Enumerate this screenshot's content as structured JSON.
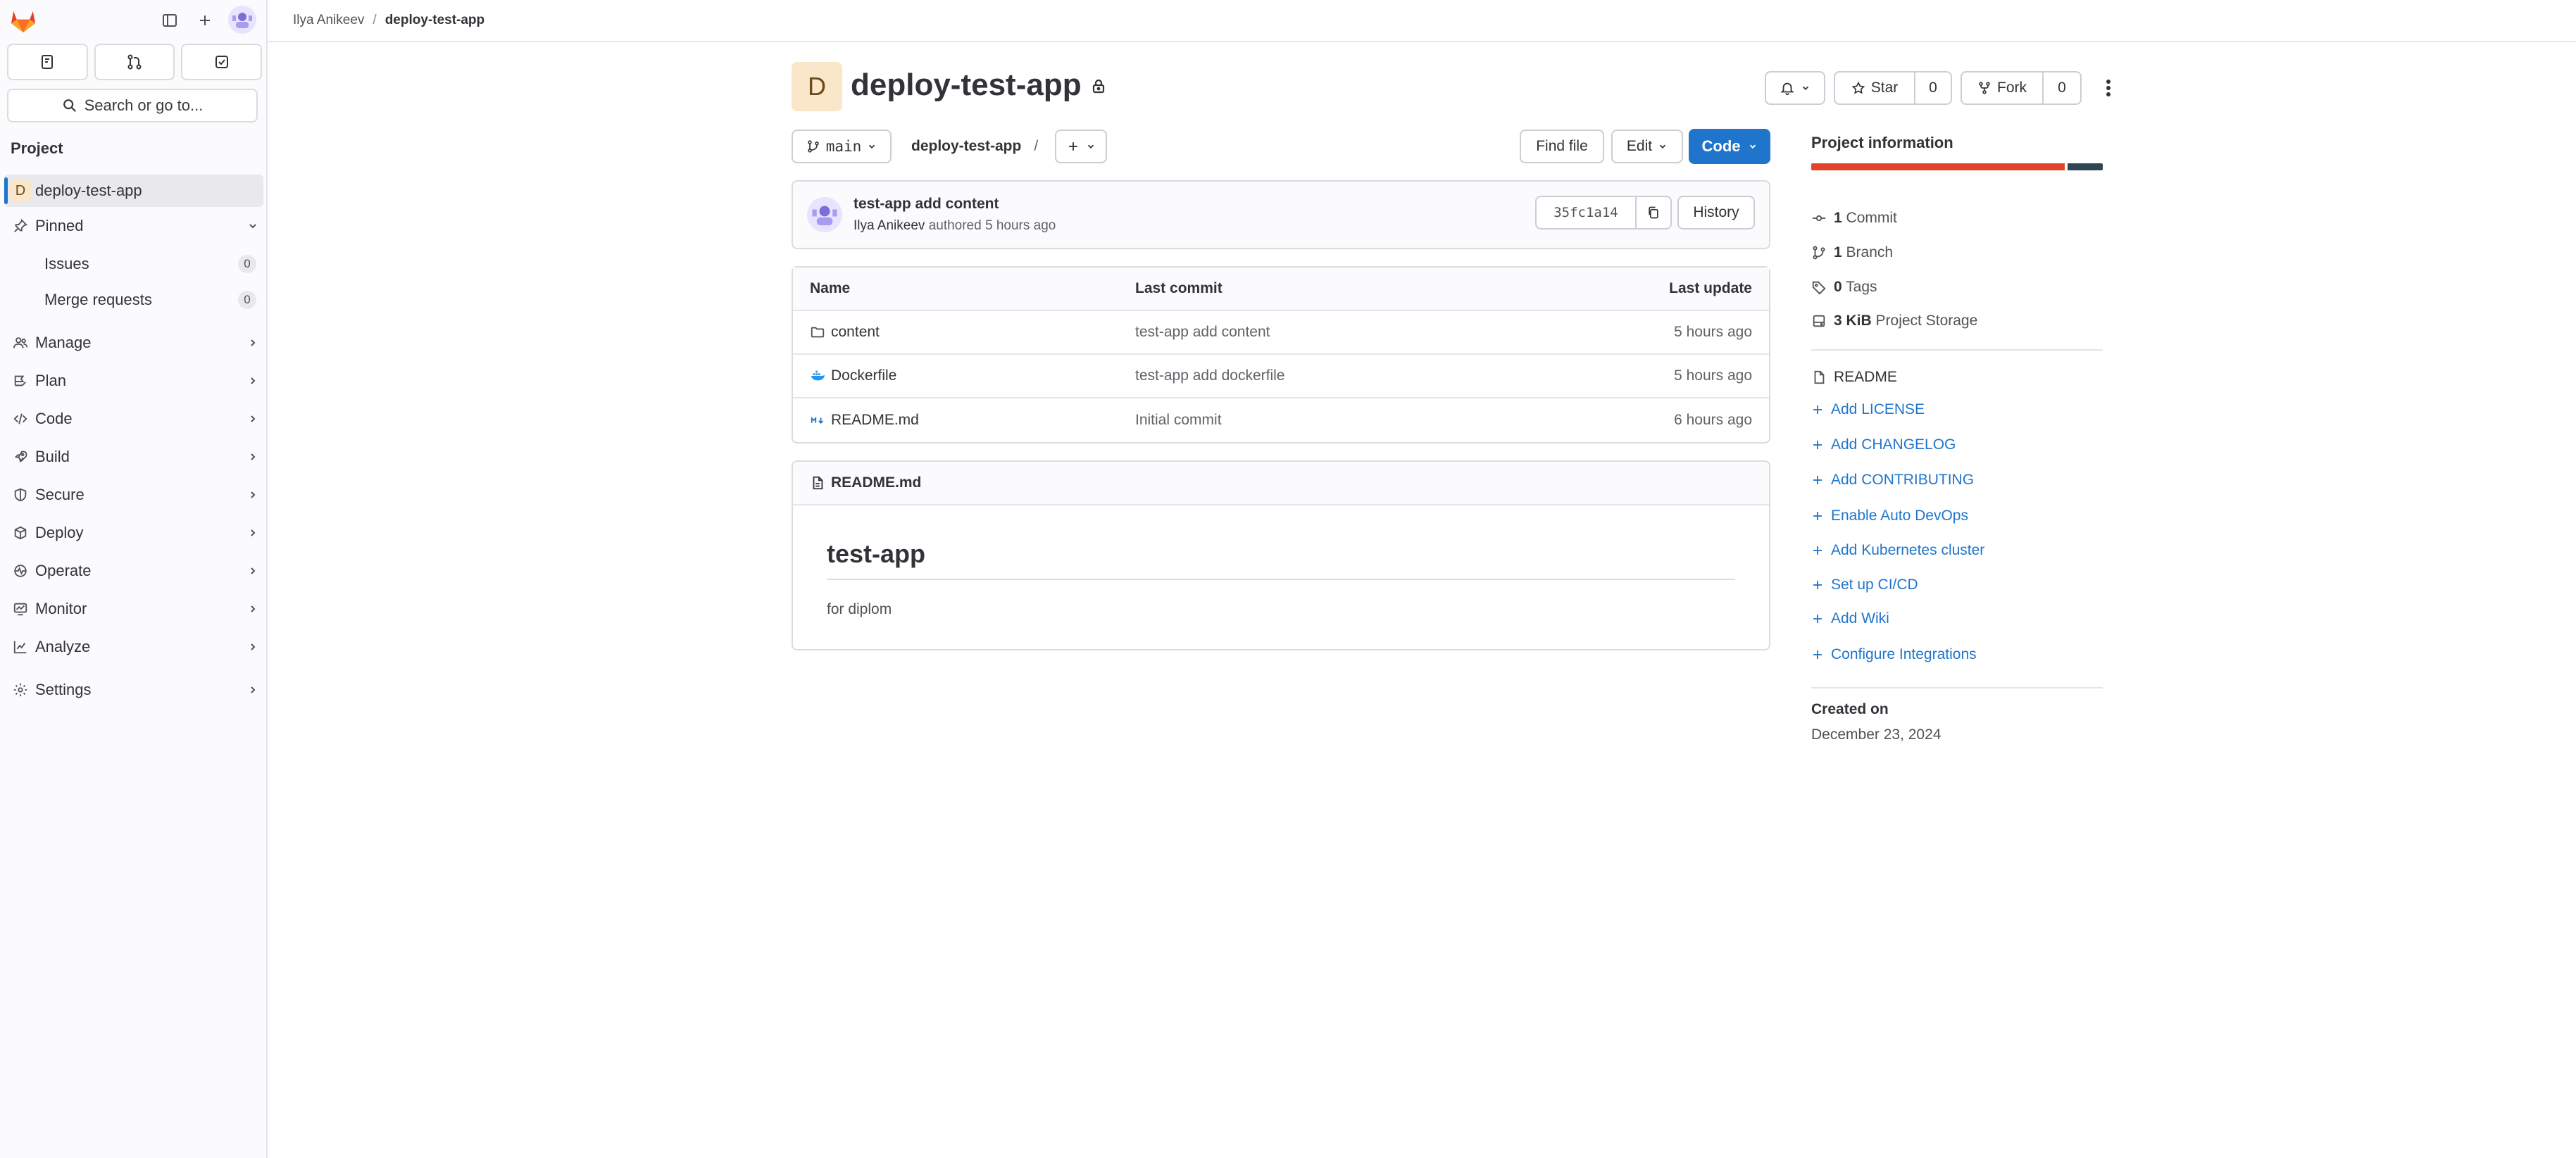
{
  "sidebar": {
    "search_placeholder": "Search or go to...",
    "section_title": "Project",
    "project": {
      "initial": "D",
      "name": "deploy-test-app"
    },
    "pinned": {
      "label": "Pinned",
      "items": [
        {
          "label": "Issues",
          "count": "0"
        },
        {
          "label": "Merge requests",
          "count": "0"
        }
      ]
    },
    "nav": [
      {
        "label": "Manage",
        "icon": "manage-icon"
      },
      {
        "label": "Plan",
        "icon": "plan-icon"
      },
      {
        "label": "Code",
        "icon": "code-icon"
      },
      {
        "label": "Build",
        "icon": "rocket-icon"
      },
      {
        "label": "Secure",
        "icon": "shield-icon"
      },
      {
        "label": "Deploy",
        "icon": "deploy-icon"
      },
      {
        "label": "Operate",
        "icon": "operate-icon"
      },
      {
        "label": "Monitor",
        "icon": "monitor-icon"
      },
      {
        "label": "Analyze",
        "icon": "chart-icon"
      },
      {
        "label": "Settings",
        "icon": "gear-icon"
      }
    ]
  },
  "breadcrumb": {
    "user": "Ilya Anikeev",
    "project": "deploy-test-app"
  },
  "project": {
    "initial": "D",
    "title": "deploy-test-app",
    "star_label": "Star",
    "star_count": "0",
    "fork_label": "Fork",
    "fork_count": "0"
  },
  "repo_bar": {
    "branch": "main",
    "path": "deploy-test-app",
    "path_sep": "/",
    "find_file": "Find file",
    "edit": "Edit",
    "code": "Code"
  },
  "last_commit": {
    "title": "test-app add content",
    "author": "Ilya Anikeev",
    "authored": "authored 5 hours ago",
    "sha": "35fc1a14",
    "history": "History"
  },
  "files": {
    "headers": {
      "name": "Name",
      "last_commit": "Last commit",
      "last_update": "Last update"
    },
    "rows": [
      {
        "name": "content",
        "icon": "folder-icon",
        "commit": "test-app add content",
        "updated": "5 hours ago"
      },
      {
        "name": "Dockerfile",
        "icon": "docker-icon",
        "commit": "test-app add dockerfile",
        "updated": "5 hours ago"
      },
      {
        "name": "README.md",
        "icon": "markdown-icon",
        "commit": "Initial commit",
        "updated": "6 hours ago"
      }
    ]
  },
  "readme": {
    "filename": "README.md",
    "heading": "test-app",
    "body": "for diplom"
  },
  "project_info": {
    "title": "Project information",
    "storage_primary_fraction": 0.87,
    "colors": {
      "primary": "#e24329",
      "secondary": "#2f4553",
      "link": "#1f75cb"
    },
    "stats": [
      {
        "count": "1",
        "label": "Commit",
        "icon": "commit-icon"
      },
      {
        "count": "1",
        "label": "Branch",
        "icon": "branch-icon"
      },
      {
        "count": "0",
        "label": "Tags",
        "icon": "tag-icon"
      },
      {
        "count": "3 KiB",
        "label": "Project Storage",
        "icon": "storage-icon"
      }
    ],
    "readme_label": "README",
    "links": [
      "Add LICENSE",
      "Add CHANGELOG",
      "Add CONTRIBUTING",
      "Enable Auto DevOps",
      "Add Kubernetes cluster",
      "Set up CI/CD",
      "Add Wiki",
      "Configure Integrations"
    ],
    "created_label": "Created on",
    "created_value": "December 23, 2024"
  }
}
